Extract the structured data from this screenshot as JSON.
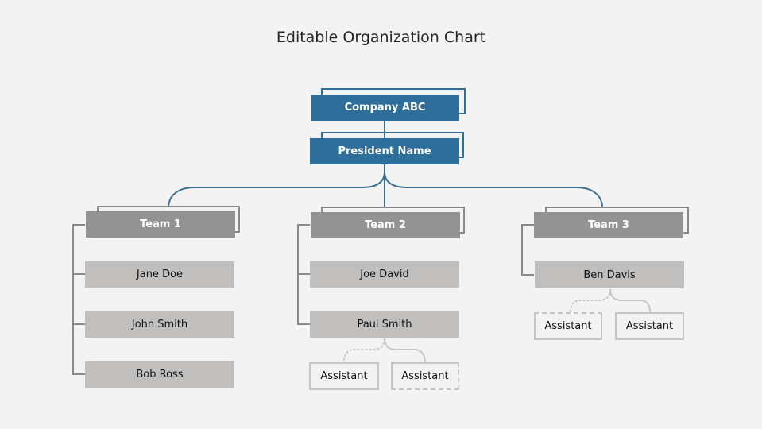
{
  "title": "Editable Organization Chart",
  "colors": {
    "top": "#2e6e9b",
    "team": "#939393",
    "member": "#c1bfbd",
    "assistant_border": "#c6c6c6",
    "connector_blue": "#3a6f8e",
    "connector_gray": "#8a8a8a"
  },
  "company": "Company ABC",
  "president": "President Name",
  "teams": [
    {
      "name": "Team 1",
      "members": [
        "Jane Doe",
        "John Smith",
        "Bob Ross"
      ],
      "assistants": []
    },
    {
      "name": "Team 2",
      "members": [
        "Joe David",
        "Paul Smith"
      ],
      "assistants": [
        "Assistant",
        "Assistant"
      ]
    },
    {
      "name": "Team 3",
      "members": [
        "Ben Davis"
      ],
      "assistants": [
        "Assistant",
        "Assistant"
      ]
    }
  ]
}
